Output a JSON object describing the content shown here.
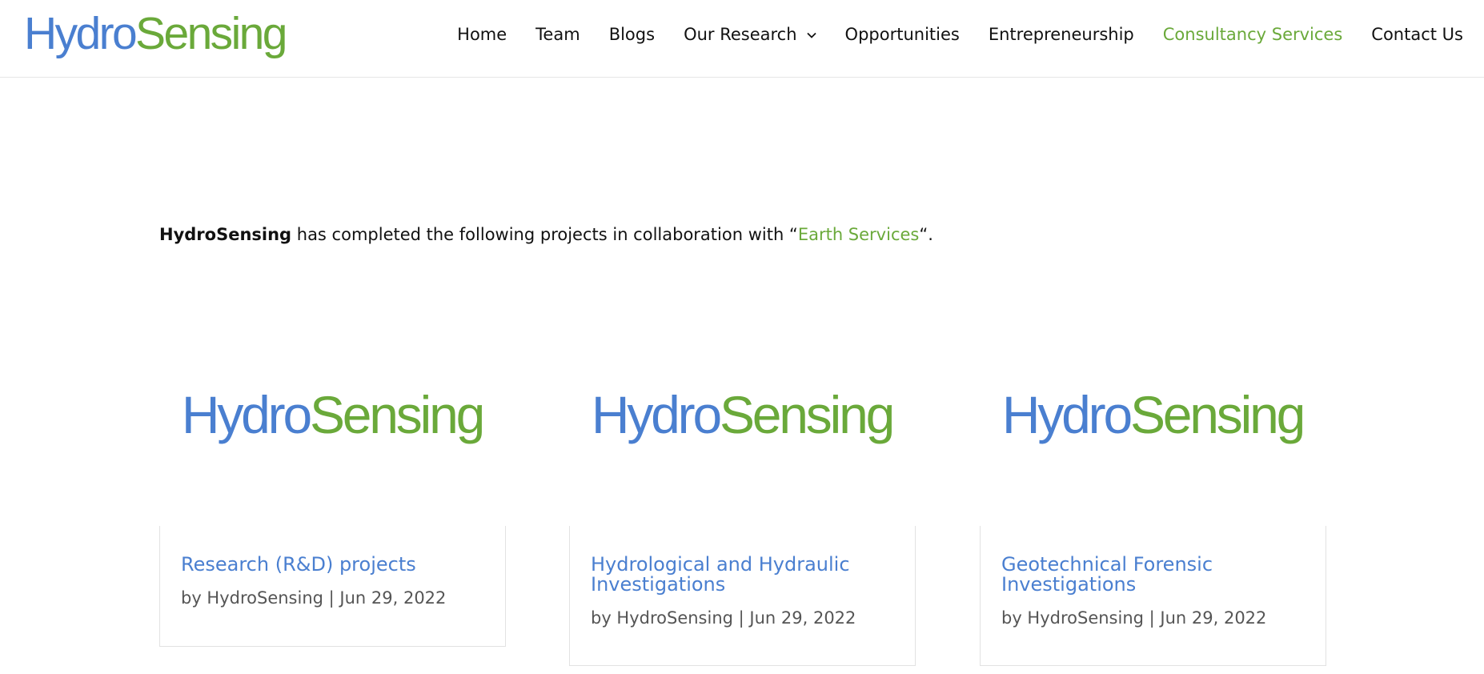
{
  "header": {
    "logo": {
      "part1": "Hydro",
      "part2": "Sensing"
    },
    "nav": [
      {
        "label": "Home"
      },
      {
        "label": "Team"
      },
      {
        "label": "Blogs"
      },
      {
        "label": "Our Research",
        "dropdown": true
      },
      {
        "label": "Opportunities"
      },
      {
        "label": "Entrepreneurship"
      },
      {
        "label": "Consultancy Services",
        "active": true
      },
      {
        "label": "Contact Us"
      }
    ]
  },
  "intro": {
    "brand": "HydroSensing",
    "text_before_link": " has completed the following projects in collaboration with “",
    "link_label": "Earth Services",
    "text_after_link": "“."
  },
  "cards": [
    {
      "logo": {
        "part1": "Hydro",
        "part2": "Sensing"
      },
      "title": "Research (R&D) projects",
      "meta": "by HydroSensing | Jun 29, 2022"
    },
    {
      "logo": {
        "part1": "Hydro",
        "part2": "Sensing"
      },
      "title": "Hydrological and Hydraulic Investigations",
      "meta": "by HydroSensing | Jun 29, 2022"
    },
    {
      "logo": {
        "part1": "Hydro",
        "part2": "Sensing"
      },
      "title": "Geotechnical Forensic Investigations",
      "meta": "by HydroSensing | Jun 29, 2022"
    }
  ],
  "colors": {
    "brand_blue": "#4a7fd0",
    "brand_green": "#6aa93a",
    "text": "#111111",
    "meta_text": "#555555"
  },
  "icons": {
    "dropdown": "chevron-down-icon"
  }
}
